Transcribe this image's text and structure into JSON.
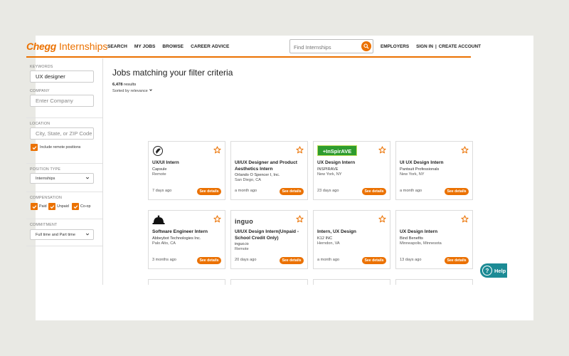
{
  "header": {
    "logo_brand": "Chegg",
    "logo_product": "Internships",
    "nav": [
      "SEARCH",
      "MY JOBS",
      "BROWSE",
      "CAREER ADVICE"
    ],
    "search_placeholder": "Find Internships",
    "employers": "EMPLOYERS",
    "sign_in": "SIGN IN",
    "separator": "|",
    "create_account": "CREATE ACCOUNT"
  },
  "sidebar": {
    "keywords_label": "KEYWORDS",
    "keywords_value": "UX designer",
    "company_label": "COMPANY",
    "company_placeholder": "Enter Company",
    "location_label": "LOCATION",
    "location_placeholder": "City, State, or ZIP Code",
    "remote_label": "Include remote positions",
    "position_type_label": "POSITION TYPE",
    "position_type_value": "Internships",
    "compensation_label": "COMPENSATION",
    "compensation_options": [
      "Paid",
      "Unpaid",
      "Co-op"
    ],
    "commitment_label": "COMMITMENT",
    "commitment_value": "Full time and Part time"
  },
  "main": {
    "title": "Jobs matching your filter criteria",
    "result_count": "6,478",
    "result_suffix": "results",
    "sorted_by": "Sorted by relevance"
  },
  "cards": [
    {
      "title": "UX/UI Intern",
      "company": "Capsule",
      "location": "Remote",
      "posted": "7 days ago",
      "button": "See details"
    },
    {
      "title": "UI/UX Designer and Product Aesthetics Intern",
      "company": "Orlando O Spencer I, Inc.",
      "location": "San Diego, CA",
      "posted": "a month ago",
      "button": "See details"
    },
    {
      "title": "UX Design Intern",
      "company": "INSPIRAVE",
      "location": "New York, NY",
      "posted": "23 days ago",
      "button": "See details",
      "logo_text": "+InSpirAVE"
    },
    {
      "title": "UI UX Design Intern",
      "company": "Pantsuit Professionals",
      "location": "New York, NY",
      "posted": "a month ago",
      "button": "See details"
    },
    {
      "title": "Software Engineer Intern",
      "company": "Abbeybot Technologies Inc.",
      "location": "Palo Alto, CA",
      "posted": "3 months ago",
      "button": "See details"
    },
    {
      "title": "UI/UX Design Intern(Unpaid - School Credit Only)",
      "company": "inguo.io",
      "location": "Remote",
      "posted": "20 days ago",
      "button": "See details",
      "logo_text": "inguo"
    },
    {
      "title": "Intern, UX Design",
      "company": "K12 INC",
      "location": "Herndon, VA",
      "posted": "a month ago",
      "button": "See details"
    },
    {
      "title": "UX Design Intern",
      "company": "Bind Benefits",
      "location": "Minneapolis, Minnesota",
      "posted": "13 days ago",
      "button": "See details"
    }
  ],
  "help": {
    "label": "Help",
    "glyph": "?"
  },
  "colors": {
    "accent": "#eb7100",
    "help": "#1c8b95",
    "background": "#e9e9e4"
  }
}
